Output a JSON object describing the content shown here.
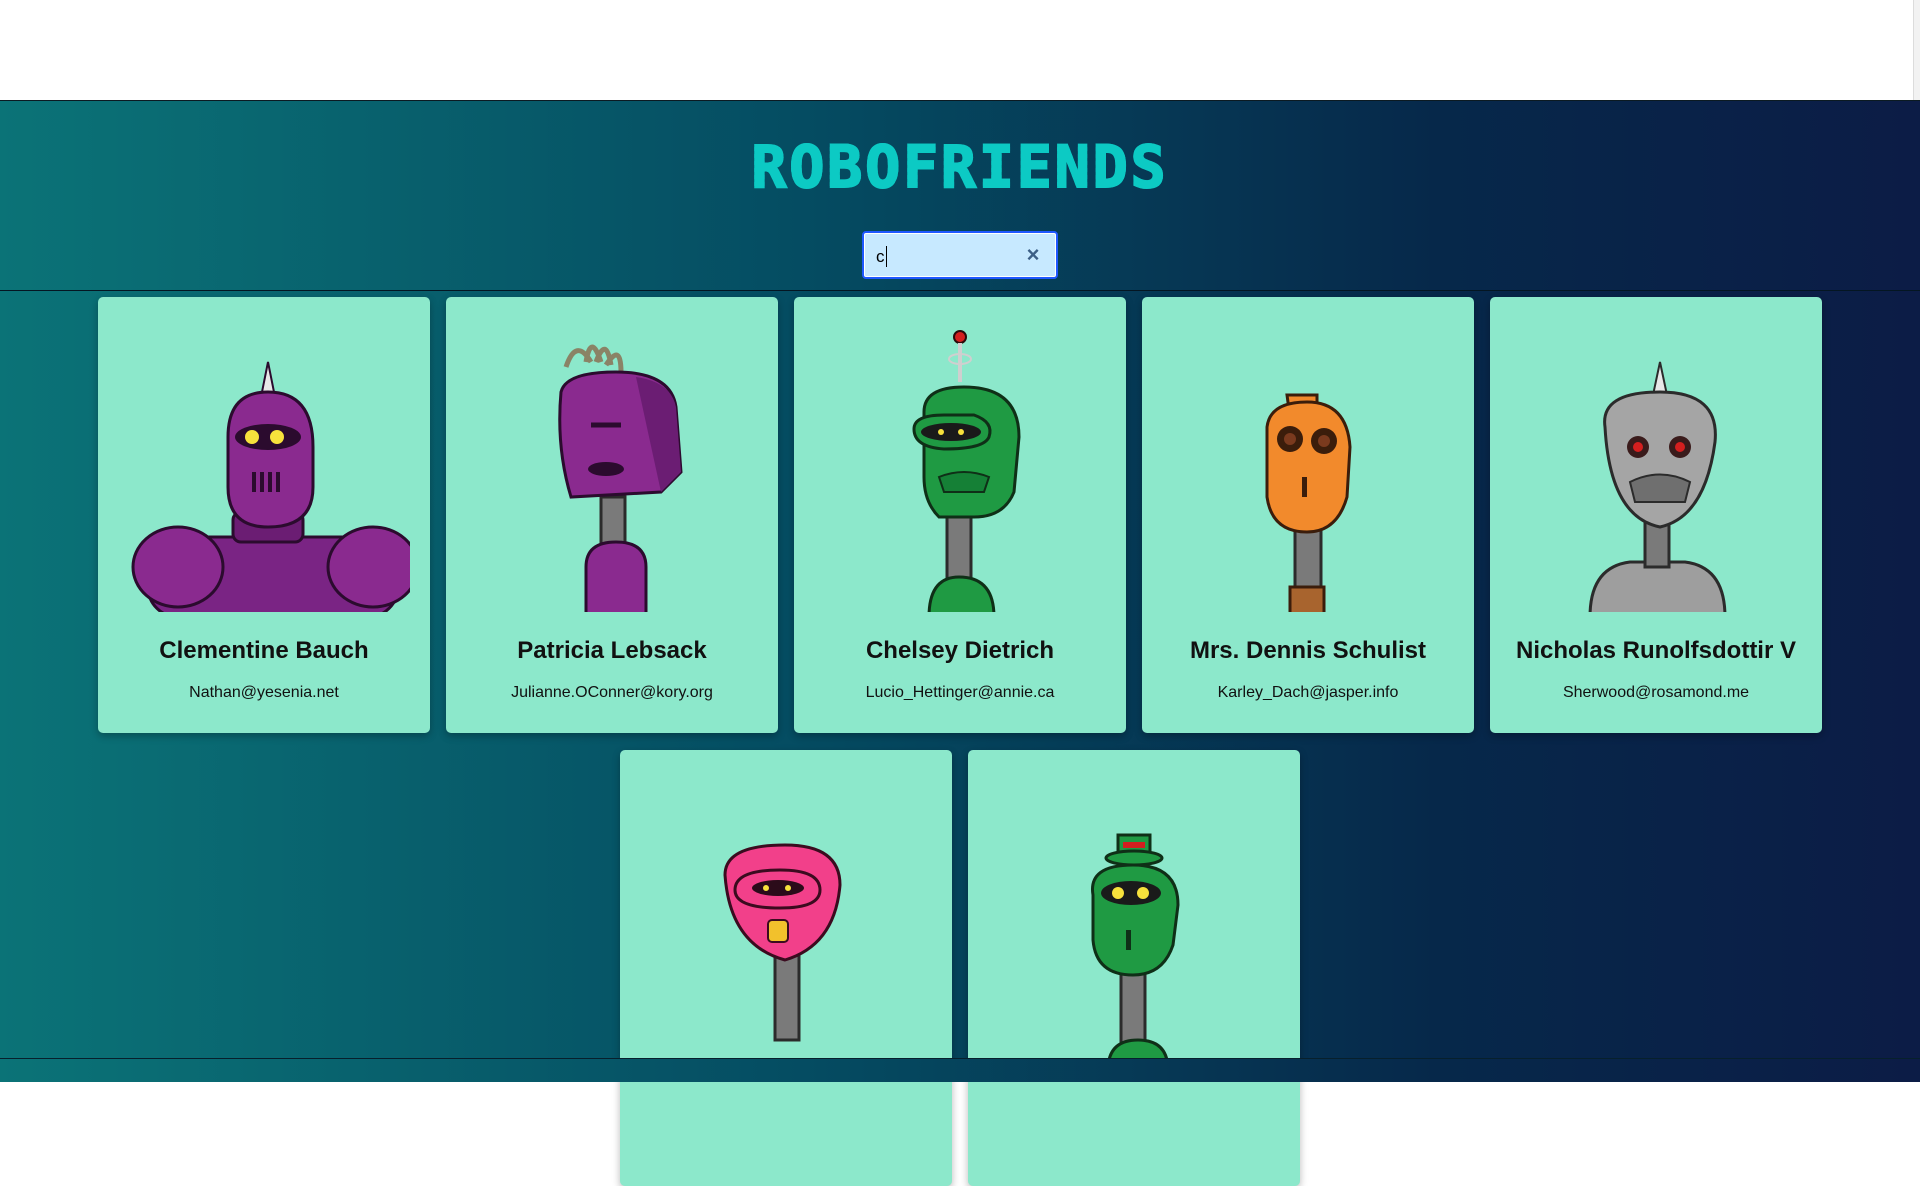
{
  "app": {
    "title": "ROBOFRIENDS",
    "colors": {
      "card_bg": "#8ce8cb",
      "logo": "#0ccac4",
      "gradient_start": "#0b7377",
      "gradient_end": "#0c1c46"
    }
  },
  "search": {
    "value": "c",
    "clear_icon": "close-icon",
    "clear_glyph": "×"
  },
  "robots": [
    {
      "name": "Clementine Bauch",
      "email": "Nathan@yesenia.net",
      "color": "#8a2a8f"
    },
    {
      "name": "Patricia Lebsack",
      "email": "Julianne.OConner@kory.org",
      "color": "#8a2a8f"
    },
    {
      "name": "Chelsey Dietrich",
      "email": "Lucio_Hettinger@annie.ca",
      "color": "#1f9a43"
    },
    {
      "name": "Mrs. Dennis Schulist",
      "email": "Karley_Dach@jasper.info",
      "color": "#f28a2c"
    },
    {
      "name": "Nicholas Runolfsdottir V",
      "email": "Sherwood@rosamond.me",
      "color": "#9e9e9e"
    },
    {
      "name": "",
      "email": "",
      "color": "#f2408a"
    },
    {
      "name": "",
      "email": "",
      "color": "#1f9a43"
    }
  ]
}
